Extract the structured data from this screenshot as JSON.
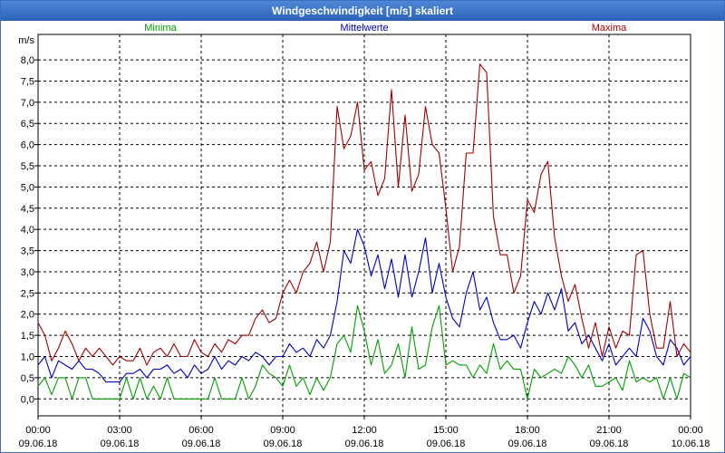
{
  "window": {
    "title": "Windgeschwindigkeit [m/s] skaliert"
  },
  "colors": {
    "min": "#00a000",
    "avg": "#0000c0",
    "max": "#a00000",
    "grid": "#000000",
    "axis": "#000000"
  },
  "chart_data": {
    "type": "line",
    "title": "Windgeschwindigkeit [m/s] skaliert",
    "ylabel": "m/s",
    "ylim": [
      -0.4,
      8.6
    ],
    "yticks": [
      "0,0",
      "0,5",
      "1,0",
      "1,5",
      "2,0",
      "2,5",
      "3,0",
      "3,5",
      "4,0",
      "4,5",
      "5,0",
      "5,5",
      "6,0",
      "6,5",
      "7,0",
      "7,5",
      "8,0"
    ],
    "x_ticks": [
      {
        "time": "00:00",
        "date": "09.06.18"
      },
      {
        "time": "03:00",
        "date": "09.06.18"
      },
      {
        "time": "06:00",
        "date": "09.06.18"
      },
      {
        "time": "09:00",
        "date": "09.06.18"
      },
      {
        "time": "12:00",
        "date": "09.06.18"
      },
      {
        "time": "15:00",
        "date": "09.06.18"
      },
      {
        "time": "18:00",
        "date": "09.06.18"
      },
      {
        "time": "21:00",
        "date": "09.06.18"
      },
      {
        "time": "00:00",
        "date": "10.06.18"
      }
    ],
    "x_unit": "hours since 09.06.18 00:00",
    "xlim": [
      0,
      24
    ],
    "grid": true,
    "legend_position": "top",
    "series": [
      {
        "name": "Minima",
        "color_key": "min",
        "points": [
          [
            0.0,
            0.3
          ],
          [
            0.25,
            0.5
          ],
          [
            0.5,
            0.1
          ],
          [
            0.75,
            0.5
          ],
          [
            1.0,
            0.5
          ],
          [
            1.25,
            0.0
          ],
          [
            1.5,
            0.5
          ],
          [
            1.75,
            0.5
          ],
          [
            2.0,
            0.0
          ],
          [
            2.25,
            0.0
          ],
          [
            2.5,
            0.0
          ],
          [
            2.75,
            0.0
          ],
          [
            3.0,
            0.0
          ],
          [
            3.25,
            0.5
          ],
          [
            3.5,
            0.0
          ],
          [
            3.75,
            0.5
          ],
          [
            4.0,
            0.0
          ],
          [
            4.25,
            0.3
          ],
          [
            4.5,
            0.0
          ],
          [
            4.75,
            0.5
          ],
          [
            5.0,
            0.0
          ],
          [
            5.25,
            0.0
          ],
          [
            5.5,
            0.0
          ],
          [
            5.75,
            0.0
          ],
          [
            6.0,
            0.0
          ],
          [
            6.25,
            0.0
          ],
          [
            6.5,
            0.5
          ],
          [
            6.75,
            0.0
          ],
          [
            7.0,
            0.0
          ],
          [
            7.25,
            0.0
          ],
          [
            7.5,
            0.5
          ],
          [
            7.75,
            0.0
          ],
          [
            8.0,
            0.3
          ],
          [
            8.25,
            0.8
          ],
          [
            8.5,
            0.6
          ],
          [
            8.75,
            0.5
          ],
          [
            9.0,
            0.3
          ],
          [
            9.25,
            0.8
          ],
          [
            9.5,
            0.3
          ],
          [
            9.75,
            0.5
          ],
          [
            10.0,
            0.1
          ],
          [
            10.25,
            0.5
          ],
          [
            10.5,
            0.2
          ],
          [
            10.75,
            0.5
          ],
          [
            11.0,
            1.3
          ],
          [
            11.25,
            1.5
          ],
          [
            11.5,
            1.1
          ],
          [
            11.75,
            2.2
          ],
          [
            12.0,
            1.6
          ],
          [
            12.25,
            0.8
          ],
          [
            12.5,
            1.4
          ],
          [
            12.75,
            0.6
          ],
          [
            13.0,
            0.8
          ],
          [
            13.25,
            1.3
          ],
          [
            13.5,
            0.5
          ],
          [
            13.75,
            1.7
          ],
          [
            14.0,
            0.7
          ],
          [
            14.25,
            0.8
          ],
          [
            14.5,
            1.7
          ],
          [
            14.75,
            2.2
          ],
          [
            15.0,
            0.8
          ],
          [
            15.25,
            0.9
          ],
          [
            15.5,
            0.8
          ],
          [
            15.75,
            0.8
          ],
          [
            16.0,
            0.5
          ],
          [
            16.25,
            0.8
          ],
          [
            16.5,
            0.6
          ],
          [
            16.75,
            1.3
          ],
          [
            17.0,
            0.7
          ],
          [
            17.25,
            0.9
          ],
          [
            17.5,
            0.7
          ],
          [
            17.75,
            0.7
          ],
          [
            18.0,
            0.0
          ],
          [
            18.25,
            0.7
          ],
          [
            18.5,
            0.5
          ],
          [
            18.75,
            0.6
          ],
          [
            19.0,
            0.7
          ],
          [
            19.25,
            0.6
          ],
          [
            19.5,
            1.0
          ],
          [
            19.75,
            0.8
          ],
          [
            20.0,
            0.5
          ],
          [
            20.25,
            0.8
          ],
          [
            20.5,
            0.3
          ],
          [
            20.75,
            0.3
          ],
          [
            21.0,
            0.4
          ],
          [
            21.25,
            0.5
          ],
          [
            21.5,
            0.2
          ],
          [
            21.75,
            0.9
          ],
          [
            22.0,
            0.4
          ],
          [
            22.25,
            0.5
          ],
          [
            22.5,
            0.4
          ],
          [
            22.75,
            0.5
          ],
          [
            23.0,
            0.0
          ],
          [
            23.25,
            0.5
          ],
          [
            23.5,
            0.0
          ],
          [
            23.75,
            0.6
          ],
          [
            24.0,
            0.5
          ]
        ]
      },
      {
        "name": "Mittelwerte",
        "color_key": "avg",
        "points": [
          [
            0.0,
            0.8
          ],
          [
            0.25,
            1.0
          ],
          [
            0.5,
            0.5
          ],
          [
            0.75,
            0.9
          ],
          [
            1.0,
            0.8
          ],
          [
            1.25,
            0.7
          ],
          [
            1.5,
            0.9
          ],
          [
            1.75,
            0.7
          ],
          [
            2.0,
            0.7
          ],
          [
            2.25,
            0.6
          ],
          [
            2.5,
            0.4
          ],
          [
            2.75,
            0.4
          ],
          [
            3.0,
            0.4
          ],
          [
            3.25,
            0.6
          ],
          [
            3.5,
            0.6
          ],
          [
            3.75,
            0.7
          ],
          [
            4.0,
            0.5
          ],
          [
            4.25,
            0.7
          ],
          [
            4.5,
            0.7
          ],
          [
            4.75,
            0.8
          ],
          [
            5.0,
            0.6
          ],
          [
            5.25,
            0.7
          ],
          [
            5.5,
            0.5
          ],
          [
            5.75,
            0.8
          ],
          [
            6.0,
            0.6
          ],
          [
            6.25,
            0.7
          ],
          [
            6.5,
            1.0
          ],
          [
            6.75,
            0.7
          ],
          [
            7.0,
            0.9
          ],
          [
            7.25,
            0.8
          ],
          [
            7.5,
            1.0
          ],
          [
            7.75,
            0.9
          ],
          [
            8.0,
            1.1
          ],
          [
            8.25,
            1.0
          ],
          [
            8.5,
            0.8
          ],
          [
            8.75,
            1.0
          ],
          [
            9.0,
            1.0
          ],
          [
            9.25,
            1.3
          ],
          [
            9.5,
            1.1
          ],
          [
            9.75,
            1.2
          ],
          [
            10.0,
            1.0
          ],
          [
            10.25,
            1.4
          ],
          [
            10.5,
            1.2
          ],
          [
            10.75,
            1.5
          ],
          [
            11.0,
            2.3
          ],
          [
            11.25,
            3.5
          ],
          [
            11.5,
            3.2
          ],
          [
            11.75,
            4.0
          ],
          [
            12.0,
            3.6
          ],
          [
            12.25,
            2.9
          ],
          [
            12.5,
            3.4
          ],
          [
            12.75,
            2.6
          ],
          [
            13.0,
            3.3
          ],
          [
            13.25,
            2.4
          ],
          [
            13.5,
            3.4
          ],
          [
            13.75,
            2.4
          ],
          [
            14.0,
            3.0
          ],
          [
            14.25,
            3.8
          ],
          [
            14.5,
            2.5
          ],
          [
            14.75,
            3.2
          ],
          [
            15.0,
            2.4
          ],
          [
            15.25,
            1.9
          ],
          [
            15.5,
            1.7
          ],
          [
            15.75,
            2.5
          ],
          [
            16.0,
            3.0
          ],
          [
            16.25,
            2.1
          ],
          [
            16.5,
            2.4
          ],
          [
            16.75,
            1.8
          ],
          [
            17.0,
            1.4
          ],
          [
            17.25,
            1.4
          ],
          [
            17.5,
            1.5
          ],
          [
            17.75,
            1.2
          ],
          [
            18.0,
            1.8
          ],
          [
            18.25,
            2.3
          ],
          [
            18.5,
            2.0
          ],
          [
            18.75,
            2.5
          ],
          [
            19.0,
            2.1
          ],
          [
            19.25,
            2.6
          ],
          [
            19.5,
            1.6
          ],
          [
            19.75,
            1.8
          ],
          [
            20.0,
            1.3
          ],
          [
            20.25,
            1.5
          ],
          [
            20.5,
            1.2
          ],
          [
            20.75,
            0.9
          ],
          [
            21.0,
            1.3
          ],
          [
            21.25,
            0.8
          ],
          [
            21.5,
            1.0
          ],
          [
            21.75,
            1.2
          ],
          [
            22.0,
            1.0
          ],
          [
            22.25,
            1.9
          ],
          [
            22.5,
            1.6
          ],
          [
            22.75,
            1.0
          ],
          [
            23.0,
            0.8
          ],
          [
            23.25,
            1.4
          ],
          [
            23.5,
            1.2
          ],
          [
            23.75,
            0.8
          ],
          [
            24.0,
            1.0
          ]
        ]
      },
      {
        "name": "Maxima",
        "color_key": "max",
        "points": [
          [
            0.0,
            1.8
          ],
          [
            0.25,
            1.5
          ],
          [
            0.5,
            0.9
          ],
          [
            0.75,
            1.2
          ],
          [
            1.0,
            1.6
          ],
          [
            1.25,
            1.3
          ],
          [
            1.5,
            0.9
          ],
          [
            1.75,
            1.2
          ],
          [
            2.0,
            1.0
          ],
          [
            2.25,
            1.2
          ],
          [
            2.5,
            1.0
          ],
          [
            2.75,
            0.8
          ],
          [
            3.0,
            1.0
          ],
          [
            3.25,
            0.9
          ],
          [
            3.5,
            0.9
          ],
          [
            3.75,
            1.2
          ],
          [
            4.0,
            0.8
          ],
          [
            4.25,
            1.1
          ],
          [
            4.5,
            1.2
          ],
          [
            4.75,
            1.0
          ],
          [
            5.0,
            1.3
          ],
          [
            5.25,
            1.0
          ],
          [
            5.5,
            1.0
          ],
          [
            5.75,
            1.4
          ],
          [
            6.0,
            1.1
          ],
          [
            6.25,
            1.0
          ],
          [
            6.5,
            1.3
          ],
          [
            6.75,
            1.1
          ],
          [
            7.0,
            1.4
          ],
          [
            7.25,
            1.3
          ],
          [
            7.5,
            1.5
          ],
          [
            7.75,
            1.5
          ],
          [
            8.0,
            1.9
          ],
          [
            8.25,
            2.1
          ],
          [
            8.5,
            1.8
          ],
          [
            8.75,
            1.9
          ],
          [
            9.0,
            2.5
          ],
          [
            9.25,
            2.8
          ],
          [
            9.5,
            2.5
          ],
          [
            9.75,
            3.0
          ],
          [
            10.0,
            3.2
          ],
          [
            10.25,
            3.7
          ],
          [
            10.5,
            3.0
          ],
          [
            10.75,
            3.7
          ],
          [
            11.0,
            6.9
          ],
          [
            11.25,
            5.9
          ],
          [
            11.5,
            6.2
          ],
          [
            11.75,
            7.0
          ],
          [
            12.0,
            5.4
          ],
          [
            12.25,
            5.6
          ],
          [
            12.5,
            4.8
          ],
          [
            12.75,
            5.2
          ],
          [
            13.0,
            7.3
          ],
          [
            13.25,
            5.0
          ],
          [
            13.5,
            6.7
          ],
          [
            13.75,
            4.9
          ],
          [
            14.0,
            5.3
          ],
          [
            14.25,
            6.9
          ],
          [
            14.5,
            6.0
          ],
          [
            14.75,
            5.8
          ],
          [
            15.0,
            4.5
          ],
          [
            15.25,
            3.0
          ],
          [
            15.5,
            3.6
          ],
          [
            15.75,
            5.8
          ],
          [
            16.0,
            5.8
          ],
          [
            16.25,
            7.9
          ],
          [
            16.5,
            7.7
          ],
          [
            16.75,
            4.3
          ],
          [
            17.0,
            3.4
          ],
          [
            17.25,
            3.4
          ],
          [
            17.5,
            2.5
          ],
          [
            17.75,
            2.9
          ],
          [
            18.0,
            4.7
          ],
          [
            18.25,
            4.4
          ],
          [
            18.5,
            5.3
          ],
          [
            18.75,
            5.6
          ],
          [
            19.0,
            3.8
          ],
          [
            19.25,
            2.9
          ],
          [
            19.5,
            2.3
          ],
          [
            19.75,
            2.7
          ],
          [
            20.0,
            1.9
          ],
          [
            20.25,
            1.2
          ],
          [
            20.5,
            1.8
          ],
          [
            20.75,
            1.0
          ],
          [
            21.0,
            1.7
          ],
          [
            21.25,
            1.2
          ],
          [
            21.5,
            1.6
          ],
          [
            21.75,
            1.5
          ],
          [
            22.0,
            3.4
          ],
          [
            22.25,
            3.5
          ],
          [
            22.5,
            2.0
          ],
          [
            22.75,
            1.2
          ],
          [
            23.0,
            1.2
          ],
          [
            23.25,
            2.3
          ],
          [
            23.5,
            1.0
          ],
          [
            23.75,
            1.3
          ],
          [
            24.0,
            1.1
          ]
        ]
      }
    ]
  }
}
